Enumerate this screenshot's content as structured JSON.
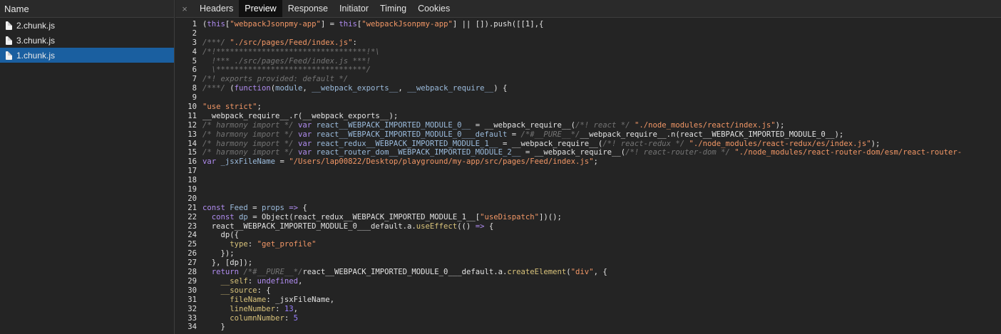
{
  "left_panel": {
    "header": "Name",
    "files": [
      {
        "name": "2.chunk.js",
        "selected": false
      },
      {
        "name": "3.chunk.js",
        "selected": false
      },
      {
        "name": "1.chunk.js",
        "selected": true
      }
    ]
  },
  "tabbar": {
    "close_glyph": "×",
    "tabs": [
      {
        "label": "Headers",
        "active": false
      },
      {
        "label": "Preview",
        "active": true
      },
      {
        "label": "Response",
        "active": false
      },
      {
        "label": "Initiator",
        "active": false
      },
      {
        "label": "Timing",
        "active": false
      },
      {
        "label": "Cookies",
        "active": false
      }
    ]
  },
  "code": {
    "lines": [
      [
        [
          "plain",
          "("
        ],
        [
          "kw",
          "this"
        ],
        [
          "plain",
          "["
        ],
        [
          "str",
          "\"webpackJsonpmy-app\""
        ],
        [
          "plain",
          "] = "
        ],
        [
          "kw",
          "this"
        ],
        [
          "plain",
          "["
        ],
        [
          "str",
          "\"webpackJsonpmy-app\""
        ],
        [
          "plain",
          "] || []).push([[1],{"
        ]
      ],
      [],
      [
        [
          "cm",
          "/***/ "
        ],
        [
          "str",
          "\"./src/pages/Feed/index.js\""
        ],
        [
          "plain",
          ":"
        ]
      ],
      [
        [
          "cm",
          "/*!*********************************!*\\"
        ]
      ],
      [
        [
          "cm",
          "  !*** ./src/pages/Feed/index.js ***!"
        ]
      ],
      [
        [
          "cm",
          "  \\*********************************/"
        ]
      ],
      [
        [
          "cm",
          "/*! exports provided: default */"
        ]
      ],
      [
        [
          "cm",
          "/***/ "
        ],
        [
          "plain",
          "("
        ],
        [
          "kw",
          "function"
        ],
        [
          "plain",
          "("
        ],
        [
          "id",
          "module"
        ],
        [
          "plain",
          ", "
        ],
        [
          "id",
          "__webpack_exports__"
        ],
        [
          "plain",
          ", "
        ],
        [
          "id",
          "__webpack_require__"
        ],
        [
          "plain",
          ") {"
        ]
      ],
      [],
      [
        [
          "str",
          "\"use strict\""
        ],
        [
          "plain",
          ";"
        ]
      ],
      [
        [
          "plain",
          "__webpack_require__.r(__webpack_exports__);"
        ]
      ],
      [
        [
          "cm",
          "/* harmony import */ "
        ],
        [
          "kw",
          "var "
        ],
        [
          "id",
          "react__WEBPACK_IMPORTED_MODULE_0__"
        ],
        [
          "plain",
          " = __webpack_require__("
        ],
        [
          "cm",
          "/*! react */ "
        ],
        [
          "str",
          "\"./node_modules/react/index.js\""
        ],
        [
          "plain",
          ");"
        ]
      ],
      [
        [
          "cm",
          "/* harmony import */ "
        ],
        [
          "kw",
          "var "
        ],
        [
          "id",
          "react__WEBPACK_IMPORTED_MODULE_0___default"
        ],
        [
          "plain",
          " = "
        ],
        [
          "cm",
          "/*#__PURE__*/"
        ],
        [
          "plain",
          "__webpack_require__.n(react__WEBPACK_IMPORTED_MODULE_0__);"
        ]
      ],
      [
        [
          "cm",
          "/* harmony import */ "
        ],
        [
          "kw",
          "var "
        ],
        [
          "id",
          "react_redux__WEBPACK_IMPORTED_MODULE_1__"
        ],
        [
          "plain",
          " = __webpack_require__("
        ],
        [
          "cm",
          "/*! react-redux */ "
        ],
        [
          "str",
          "\"./node_modules/react-redux/es/index.js\""
        ],
        [
          "plain",
          ");"
        ]
      ],
      [
        [
          "cm",
          "/* harmony import */ "
        ],
        [
          "kw",
          "var "
        ],
        [
          "id",
          "react_router_dom__WEBPACK_IMPORTED_MODULE_2__"
        ],
        [
          "plain",
          " = __webpack_require__("
        ],
        [
          "cm",
          "/*! react-router-dom */ "
        ],
        [
          "str",
          "\"./node_modules/react-router-dom/esm/react-router-"
        ]
      ],
      [
        [
          "kw",
          "var "
        ],
        [
          "id",
          "_jsxFileName"
        ],
        [
          "plain",
          " = "
        ],
        [
          "str",
          "\"/Users/lap00822/Desktop/playground/my-app/src/pages/Feed/index.js\""
        ],
        [
          "plain",
          ";"
        ]
      ],
      [],
      [],
      [],
      [],
      [
        [
          "kw",
          "const "
        ],
        [
          "id",
          "Feed"
        ],
        [
          "plain",
          " = "
        ],
        [
          "id",
          "props"
        ],
        [
          "plain",
          " "
        ],
        [
          "kw",
          "=>"
        ],
        [
          "plain",
          " {"
        ]
      ],
      [
        [
          "plain",
          "  "
        ],
        [
          "kw",
          "const "
        ],
        [
          "id",
          "dp"
        ],
        [
          "plain",
          " = Object(react_redux__WEBPACK_IMPORTED_MODULE_1__["
        ],
        [
          "str",
          "\"useDispatch\""
        ],
        [
          "plain",
          "])();"
        ]
      ],
      [
        [
          "plain",
          "  react__WEBPACK_IMPORTED_MODULE_0___default.a."
        ],
        [
          "prop",
          "useEffect"
        ],
        [
          "plain",
          "(() "
        ],
        [
          "kw",
          "=>"
        ],
        [
          "plain",
          " {"
        ]
      ],
      [
        [
          "plain",
          "    dp({"
        ]
      ],
      [
        [
          "plain",
          "      "
        ],
        [
          "prop",
          "type"
        ],
        [
          "plain",
          ": "
        ],
        [
          "str",
          "\"get_profile\""
        ]
      ],
      [
        [
          "plain",
          "    });"
        ]
      ],
      [
        [
          "plain",
          "  }, [dp]);"
        ]
      ],
      [
        [
          "plain",
          "  "
        ],
        [
          "kw",
          "return "
        ],
        [
          "cm",
          "/*#__PURE__*/"
        ],
        [
          "plain",
          "react__WEBPACK_IMPORTED_MODULE_0___default.a."
        ],
        [
          "prop",
          "createElement"
        ],
        [
          "plain",
          "("
        ],
        [
          "str",
          "\"div\""
        ],
        [
          "plain",
          ", {"
        ]
      ],
      [
        [
          "plain",
          "    "
        ],
        [
          "prop",
          "__self"
        ],
        [
          "plain",
          ": "
        ],
        [
          "kw",
          "undefined"
        ],
        [
          "plain",
          ","
        ]
      ],
      [
        [
          "plain",
          "    "
        ],
        [
          "prop",
          "__source"
        ],
        [
          "plain",
          ": {"
        ]
      ],
      [
        [
          "plain",
          "      "
        ],
        [
          "prop",
          "fileName"
        ],
        [
          "plain",
          ": _jsxFileName,"
        ]
      ],
      [
        [
          "plain",
          "      "
        ],
        [
          "prop",
          "lineNumber"
        ],
        [
          "plain",
          ": "
        ],
        [
          "num",
          "13"
        ],
        [
          "plain",
          ","
        ]
      ],
      [
        [
          "plain",
          "      "
        ],
        [
          "prop",
          "columnNumber"
        ],
        [
          "plain",
          ": "
        ],
        [
          "num",
          "5"
        ]
      ],
      [
        [
          "plain",
          "    }"
        ]
      ]
    ]
  },
  "colors": {
    "background": "#242424",
    "selected_row": "#1a5fa0",
    "keyword": "#b08cf0",
    "string": "#f29766",
    "comment": "#747474",
    "identifier": "#9bbbdc",
    "property": "#d8c27a",
    "number": "#9980ff"
  }
}
